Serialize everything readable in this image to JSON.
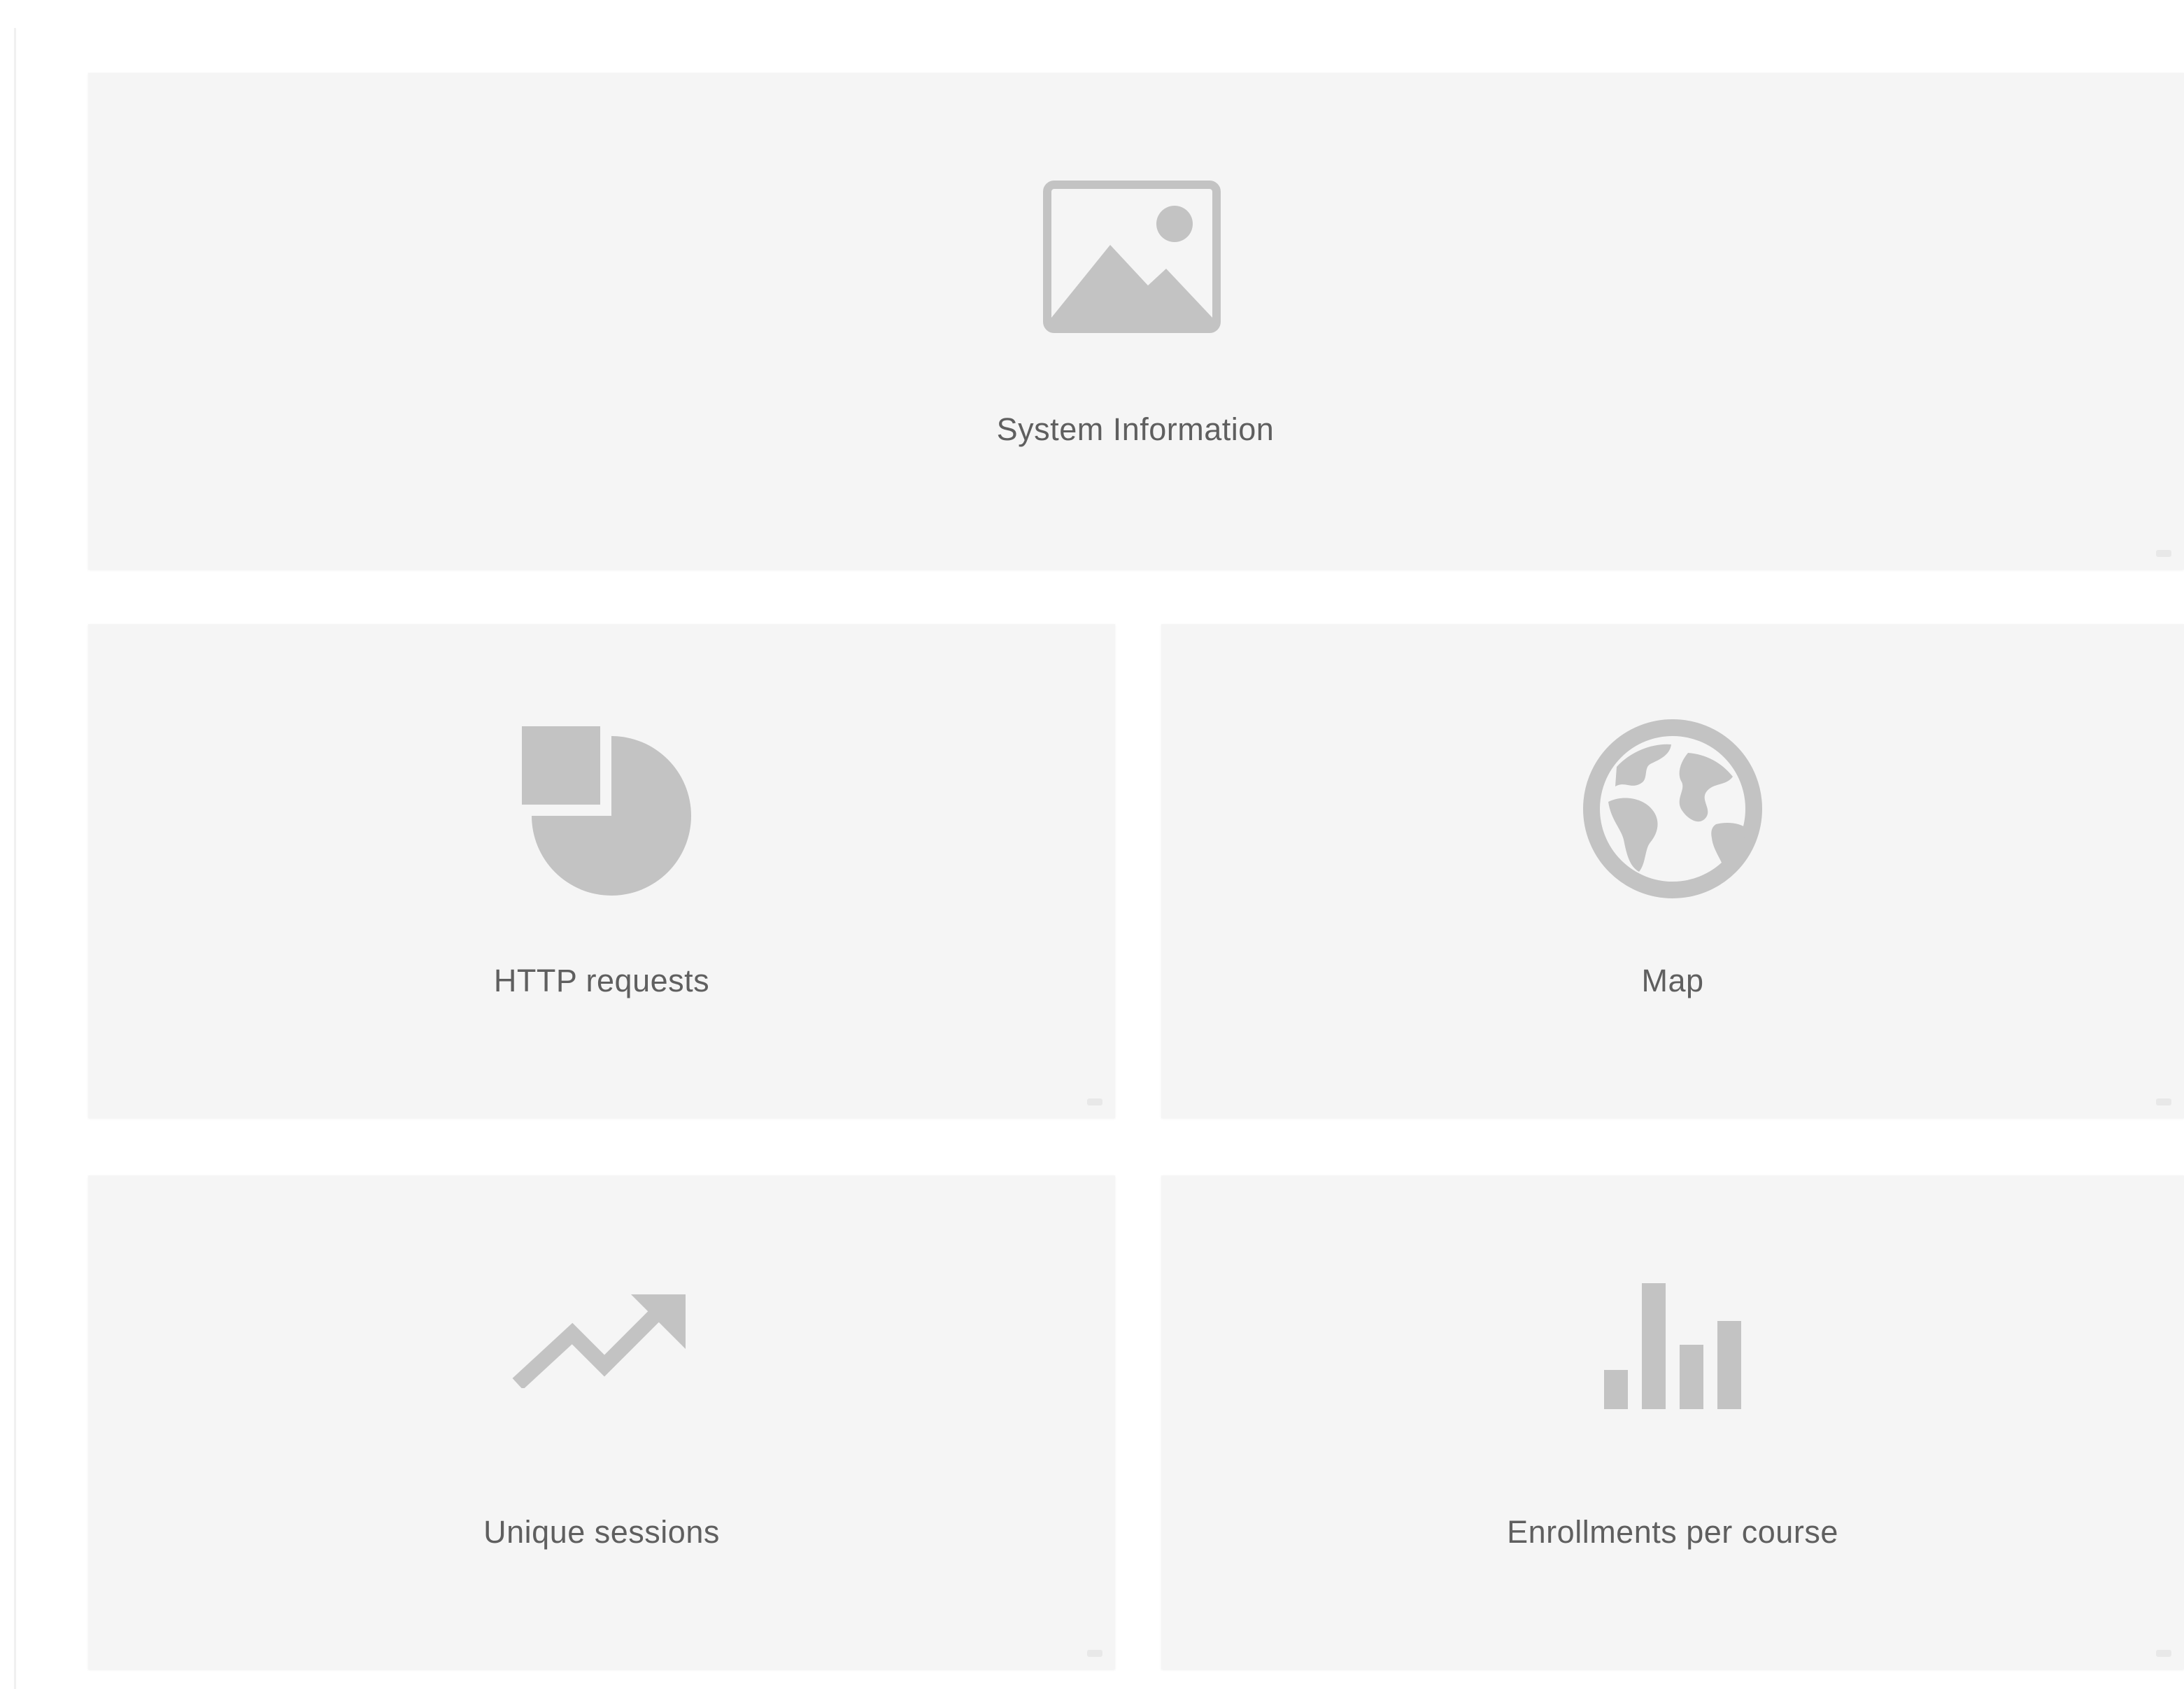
{
  "colors": {
    "background": "#ffffff",
    "widget_background": "#f5f5f5",
    "icon": "#c3c3c3",
    "label": "#5f5f5f"
  },
  "dashboard": {
    "widgets": [
      {
        "label": "System Information",
        "icon": "image-icon"
      },
      {
        "label": "HTTP requests",
        "icon": "pie-chart-icon"
      },
      {
        "label": "Map",
        "icon": "globe-icon"
      },
      {
        "label": "Unique sessions",
        "icon": "trending-up-icon"
      },
      {
        "label": "Enrollments per course",
        "icon": "bar-chart-icon"
      }
    ]
  }
}
